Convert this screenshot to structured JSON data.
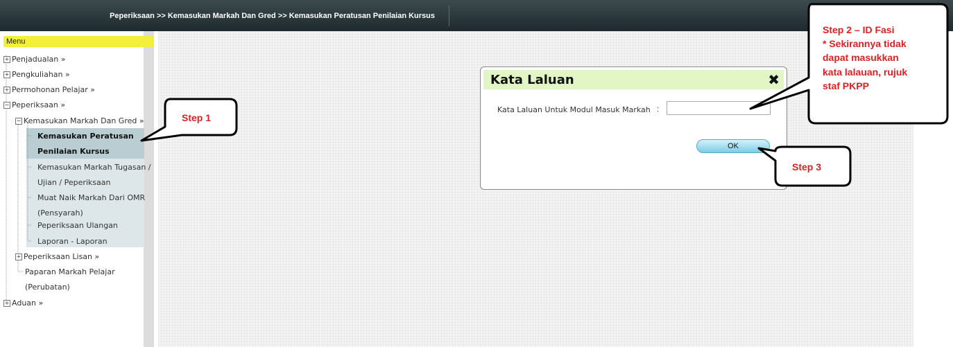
{
  "header": {
    "breadcrumb": "Peperiksaan >> Kemasukan Markah Dan Gred >> Kemasukan Peratusan Penilaian Kursus"
  },
  "menu": {
    "title": "Menu",
    "items": [
      "Penjadualan »",
      "Pengkuliahan »",
      "Permohonan Pelajar »",
      "Peperiksaan »",
      "Kemasukan Markah Dan Gred »",
      "Kemasukan Peratusan",
      "Penilaian Kursus",
      "Kemasukan Markah Tugasan /",
      "Ujian / Peperiksaan",
      "Muat Naik Markah Dari OMR",
      "(Pensyarah)",
      "Peperiksaan Ulangan",
      "Laporan - Laporan",
      "Peperiksaan Lisan »",
      "Paparan Markah Pelajar",
      "(Perubatan)",
      "Aduan »"
    ]
  },
  "dialog": {
    "title": "Kata Laluan",
    "field_label": "Kata Laluan Untuk Modul Masuk Markah",
    "colon": ":",
    "input_value": "",
    "ok_label": "OK"
  },
  "callouts": {
    "step1": "Step 1",
    "step2_l1": "Step 2 – ID Fasi",
    "step2_l2": "* Sekirannya tidak",
    "step2_l3": "dapat masukkan",
    "step2_l4": "kata lalauan, rujuk",
    "step2_l5": "staf PKPP",
    "step3": "Step 3"
  },
  "icons": {
    "close": "close-icon",
    "toggle": "tree-toggle-icon"
  },
  "colors": {
    "menu_header": "#f3ef3a",
    "dialog_header": "#e1f5c5",
    "callout_text": "#e02020"
  }
}
